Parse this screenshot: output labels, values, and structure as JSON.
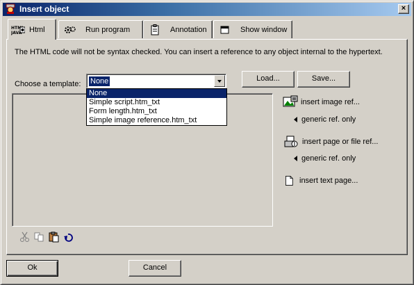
{
  "window": {
    "title": "Insert object",
    "close_label": "×"
  },
  "tabs": [
    {
      "label": "Html",
      "icon": "html-java-icon",
      "active": true
    },
    {
      "label": "Run program",
      "icon": "gears-icon",
      "active": false
    },
    {
      "label": "Annotation",
      "icon": "clipboard-icon",
      "active": false
    },
    {
      "label": "Show window",
      "icon": "window-icon",
      "active": false
    }
  ],
  "panel": {
    "info_text": "The HTML code will not be syntax checked. You can insert a reference to any object internal to the hypertext.",
    "choose_label": "Choose a template:",
    "template_combo": {
      "value": "None"
    },
    "template_options": [
      "None",
      "Simple script.htm_txt",
      "Form length.htm_txt",
      "Simple image reference.htm_txt"
    ],
    "load_label": "Load...",
    "save_label": "Save..."
  },
  "side": {
    "insert_image": "insert image ref...",
    "generic1": "generic ref. only",
    "insert_page": "insert page or file ref...",
    "generic2": "generic ref. only",
    "insert_text": "insert text page..."
  },
  "footer": {
    "ok_label": "Ok",
    "cancel_label": "Cancel"
  },
  "colors": {
    "title_start": "#0a246a",
    "title_end": "#a6caf0",
    "face": "#d4d0c8",
    "selection": "#0a246a"
  }
}
